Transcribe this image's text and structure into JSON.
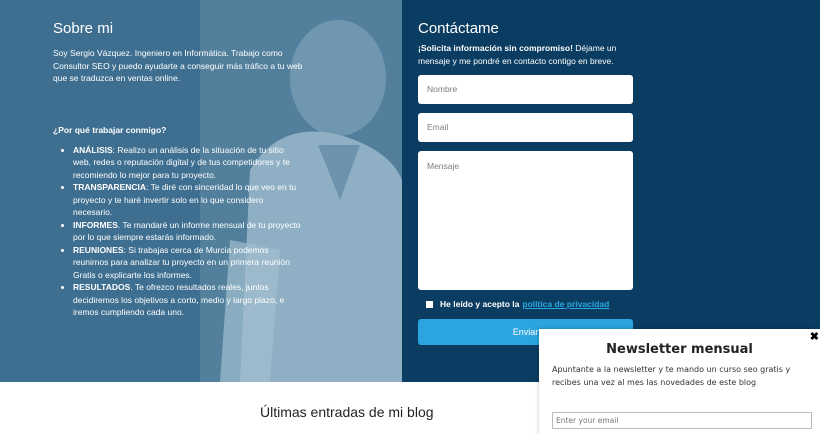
{
  "about": {
    "title": "Sobre mi",
    "text": "Soy Sergio Vázquez. Ingeniero en Informática. Trabajo como Consultor SEO y puedo ayudarte a conseguir más tráfico a tu web que se traduzca en ventas online.",
    "why_title": "¿Por qué trabajar conmigo?",
    "points": [
      {
        "label": "ANÁLISIS",
        "text": ": Realizo un análisis de la situación de tu sitio web, redes o reputación digital y de tus competidores y te recomiendo lo mejor para tu proyecto."
      },
      {
        "label": "TRANSPARENCIA",
        "text": ": Te diré con sinceridad lo que veo en tu proyecto y te haré invertir solo en lo que considero necesario."
      },
      {
        "label": "INFORMES",
        "text": ". Te mandaré un informe mensual de tu proyecto por lo que siempre estarás informado."
      },
      {
        "label": "REUNIONES",
        "text": ": Si trabajas cerca de Murcia podemos reunirnos para analizar tu proyecto en un primera reunión Gratis o explicarte los informes."
      },
      {
        "label": "RESULTADOS",
        "text": ". Te ofrezco resultados reales, juntos decidiremos los objetivos a corto, medio y largo plazo, e iremos cumpliendo cada uno."
      }
    ]
  },
  "contact": {
    "title": "Contáctame",
    "intro_bold": "¡Solicita información sin compromiso!",
    "intro_rest": " Déjame un mensaje y me pondré en contacto contigo en breve.",
    "name_placeholder": "Nombre",
    "email_placeholder": "Email",
    "message_placeholder": "Mensaje",
    "consent_text": "He leído y acepto la",
    "consent_link": "política de privacidad",
    "send_label": "Enviar"
  },
  "blog": {
    "title": "Últimas entradas de mi blog"
  },
  "newsletter": {
    "close": "✖",
    "title": "Newsletter mensual",
    "text": "Apuntante a la newsletter y te mando un curso seo gratis y recibes una vez al mes las novedades de este blog",
    "email_placeholder": "Enter your email"
  }
}
